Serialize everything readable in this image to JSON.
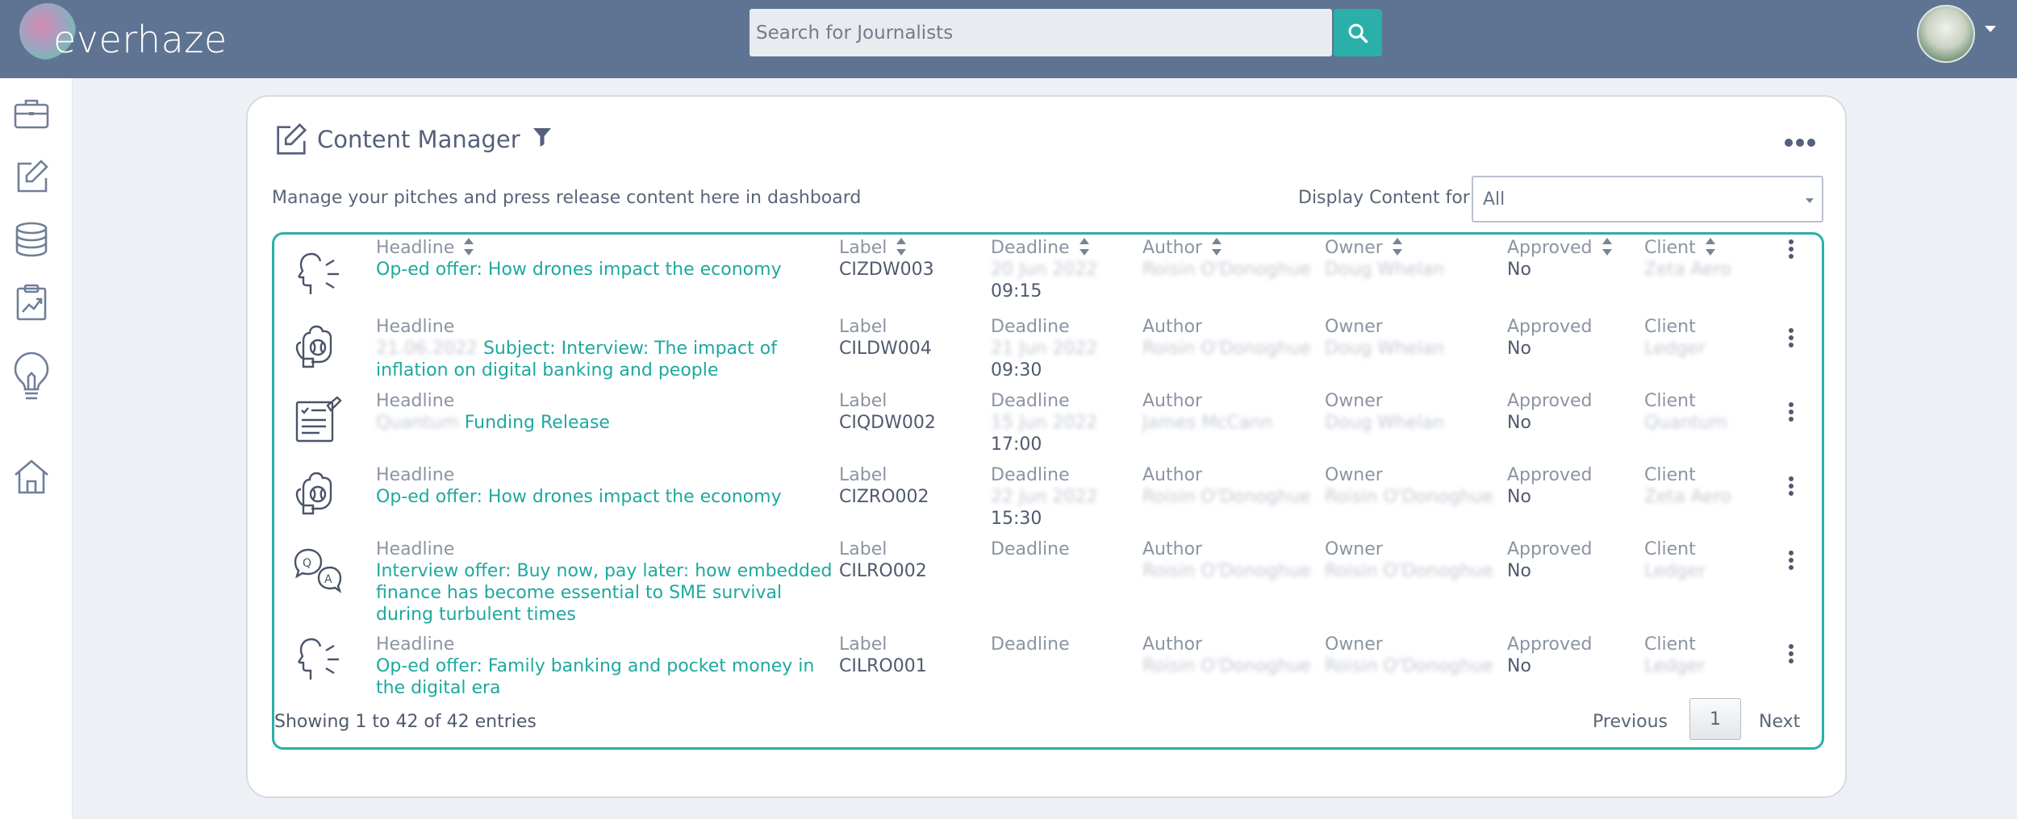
{
  "brand": {
    "name": "everhaze"
  },
  "search": {
    "placeholder": "Search for Journalists"
  },
  "sidebar": {
    "items": [
      "briefcase-icon",
      "edit-icon",
      "database-icon",
      "clipboard-chart-icon",
      "lightbulb-icon",
      "home-icon"
    ]
  },
  "content_manager": {
    "title": "Content Manager",
    "subtitle": "Manage your pitches and press release content here in dashboard",
    "display_label": "Display Content for:",
    "display_value": "All"
  },
  "columns": {
    "headline": "Headline",
    "label": "Label",
    "deadline": "Deadline",
    "author": "Author",
    "owner": "Owner",
    "approved": "Approved",
    "client": "Client"
  },
  "rows": [
    {
      "icon": "speaking-head-icon",
      "headline": "Op-ed offer: How drones impact the economy",
      "headline_prefix": "",
      "label": "CIZDW003",
      "deadline_date": "20 Jun 2022",
      "deadline_time": "09:15",
      "author": "Roisin O'Donoghue",
      "owner": "Doug Whelan",
      "approved": "No",
      "client": "Zeta Aero"
    },
    {
      "icon": "baseball-glove-icon",
      "headline": "Subject: Interview: The impact of inflation on digital banking and people",
      "headline_prefix": "21.06.2022",
      "label": "CILDW004",
      "deadline_date": "21 Jun 2022",
      "deadline_time": "09:30",
      "author": "Roisin O'Donoghue",
      "owner": "Doug Whelan",
      "approved": "No",
      "client": "Ledger"
    },
    {
      "icon": "document-list-icon",
      "headline": "Funding Release",
      "headline_prefix": "Quantum",
      "label": "CIQDW002",
      "deadline_date": "15 Jun 2022",
      "deadline_time": "17:00",
      "author": "James McCann",
      "owner": "Doug Whelan",
      "approved": "No",
      "client": "Quantum"
    },
    {
      "icon": "baseball-glove-icon",
      "headline": "Op-ed offer: How drones impact the economy",
      "headline_prefix": "",
      "label": "CIZRO002",
      "deadline_date": "22 Jun 2022",
      "deadline_time": "15:30",
      "author": "Roisin O'Donoghue",
      "owner": "Roisin O'Donoghue",
      "approved": "No",
      "client": "Zeta Aero"
    },
    {
      "icon": "qa-chat-icon",
      "headline": "Interview offer: Buy now, pay later: how embedded finance has become essential to SME survival during turbulent times",
      "headline_prefix": "",
      "label": "CILRO002",
      "deadline_date": "",
      "deadline_time": "",
      "author": "Roisin O'Donoghue",
      "owner": "Roisin O'Donoghue",
      "approved": "No",
      "client": "Ledger"
    },
    {
      "icon": "speaking-head-icon",
      "headline": "Op-ed offer: Family banking and pocket money in the digital era",
      "headline_prefix": "",
      "label": "CILRO001",
      "deadline_date": "",
      "deadline_time": "",
      "author": "Roisin O'Donoghue",
      "owner": "Roisin O'Donoghue",
      "approved": "No",
      "client": "Ledger"
    }
  ],
  "footer": {
    "info": "Showing 1 to 42 of 42 entries",
    "previous": "Previous",
    "page": "1",
    "next": "Next"
  },
  "colors": {
    "topbar": "#5f7392",
    "accent": "#2ab0a8",
    "link": "#1ea89f"
  }
}
